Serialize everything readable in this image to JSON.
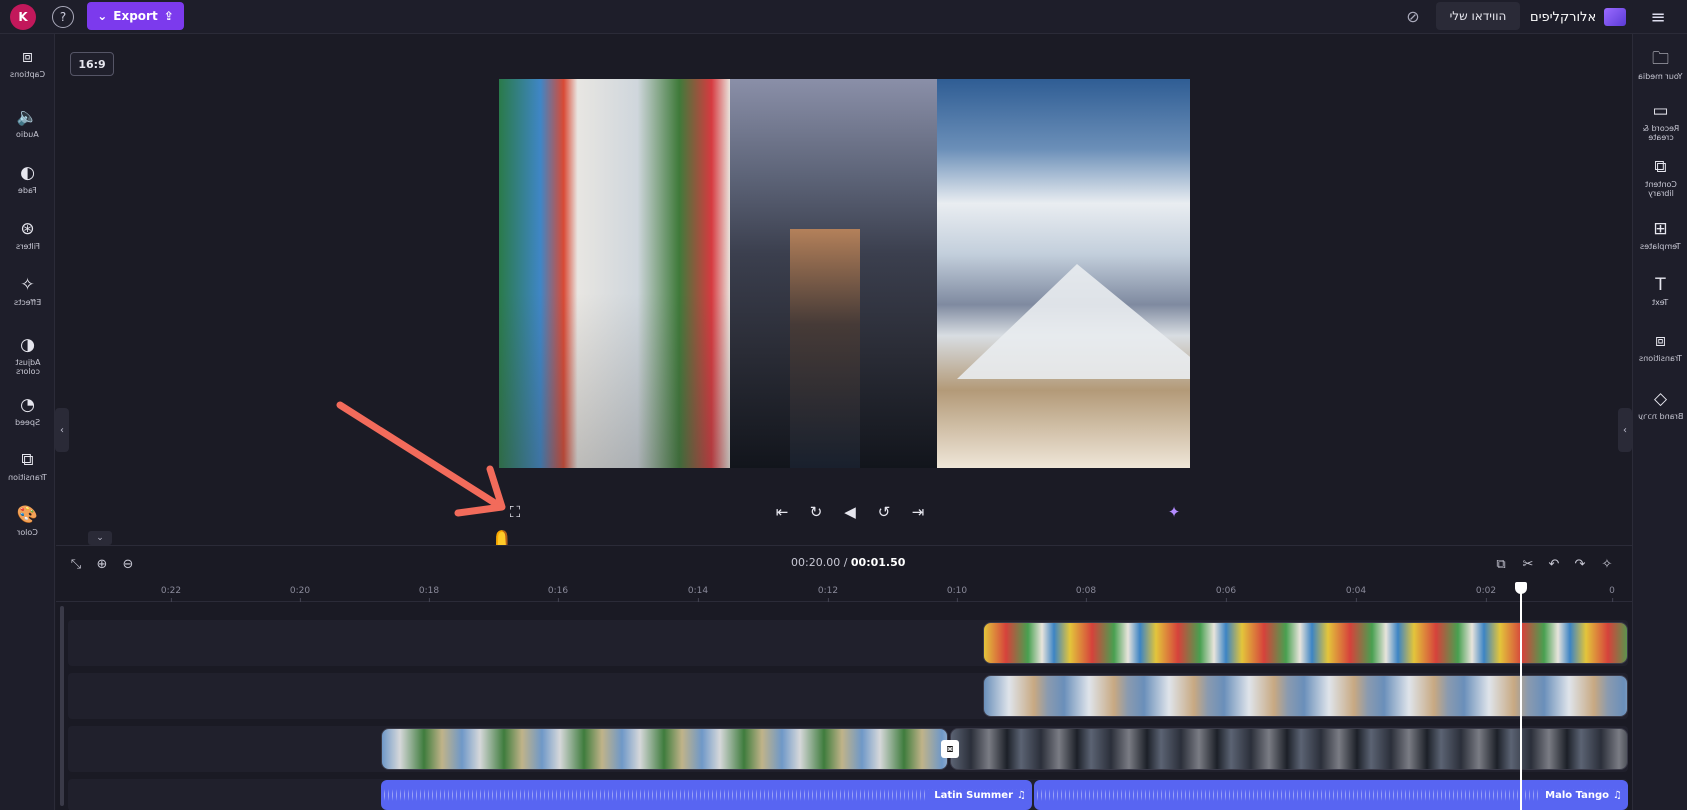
{
  "header": {
    "avatar_initial": "K",
    "help_icon": "?",
    "export_label": "Export",
    "my_videos_label": "הווידאו שלי",
    "brand_name": "אלורקליפים",
    "menu_icon": "≡"
  },
  "left_sidebar": {
    "items": [
      {
        "label": "Captions",
        "icon": "⧈"
      },
      {
        "label": "Audio",
        "icon": "🔈"
      },
      {
        "label": "Fade",
        "icon": "◐"
      },
      {
        "label": "Filters",
        "icon": "⊛"
      },
      {
        "label": "Effects",
        "icon": "✧"
      },
      {
        "label": "Adjust colors",
        "icon": "◑"
      },
      {
        "label": "Speed",
        "icon": "◔"
      },
      {
        "label": "Transition",
        "icon": "⧉"
      },
      {
        "label": "Color",
        "icon": "🎨"
      }
    ]
  },
  "right_sidebar": {
    "items": [
      {
        "label": "Your media",
        "icon": "🗀"
      },
      {
        "label": "Record & create",
        "icon": "▭"
      },
      {
        "label": "Content library",
        "icon": "⧉"
      },
      {
        "label": "Templates",
        "icon": "⊞"
      },
      {
        "label": "Text",
        "icon": "T"
      },
      {
        "label": "Transitions",
        "icon": "⧈"
      },
      {
        "label": "Brand ערכת",
        "icon": "◇"
      }
    ]
  },
  "preview": {
    "aspect_ratio": "16:9"
  },
  "timeline": {
    "current_time": "00:01.50",
    "total_time": "00:20.00",
    "ruler": [
      "0:22",
      "0:20",
      "0:18",
      "0:16",
      "0:14",
      "0:12",
      "0:10",
      "0:08",
      "0:06",
      "0:04",
      "0:02",
      "0"
    ],
    "audio_tracks": [
      "Latin Summer",
      "Malo Tango"
    ]
  },
  "colors": {
    "accent": "#7c3aed",
    "audio_clip": "#5865f2",
    "annotation": "#f26b5b"
  }
}
